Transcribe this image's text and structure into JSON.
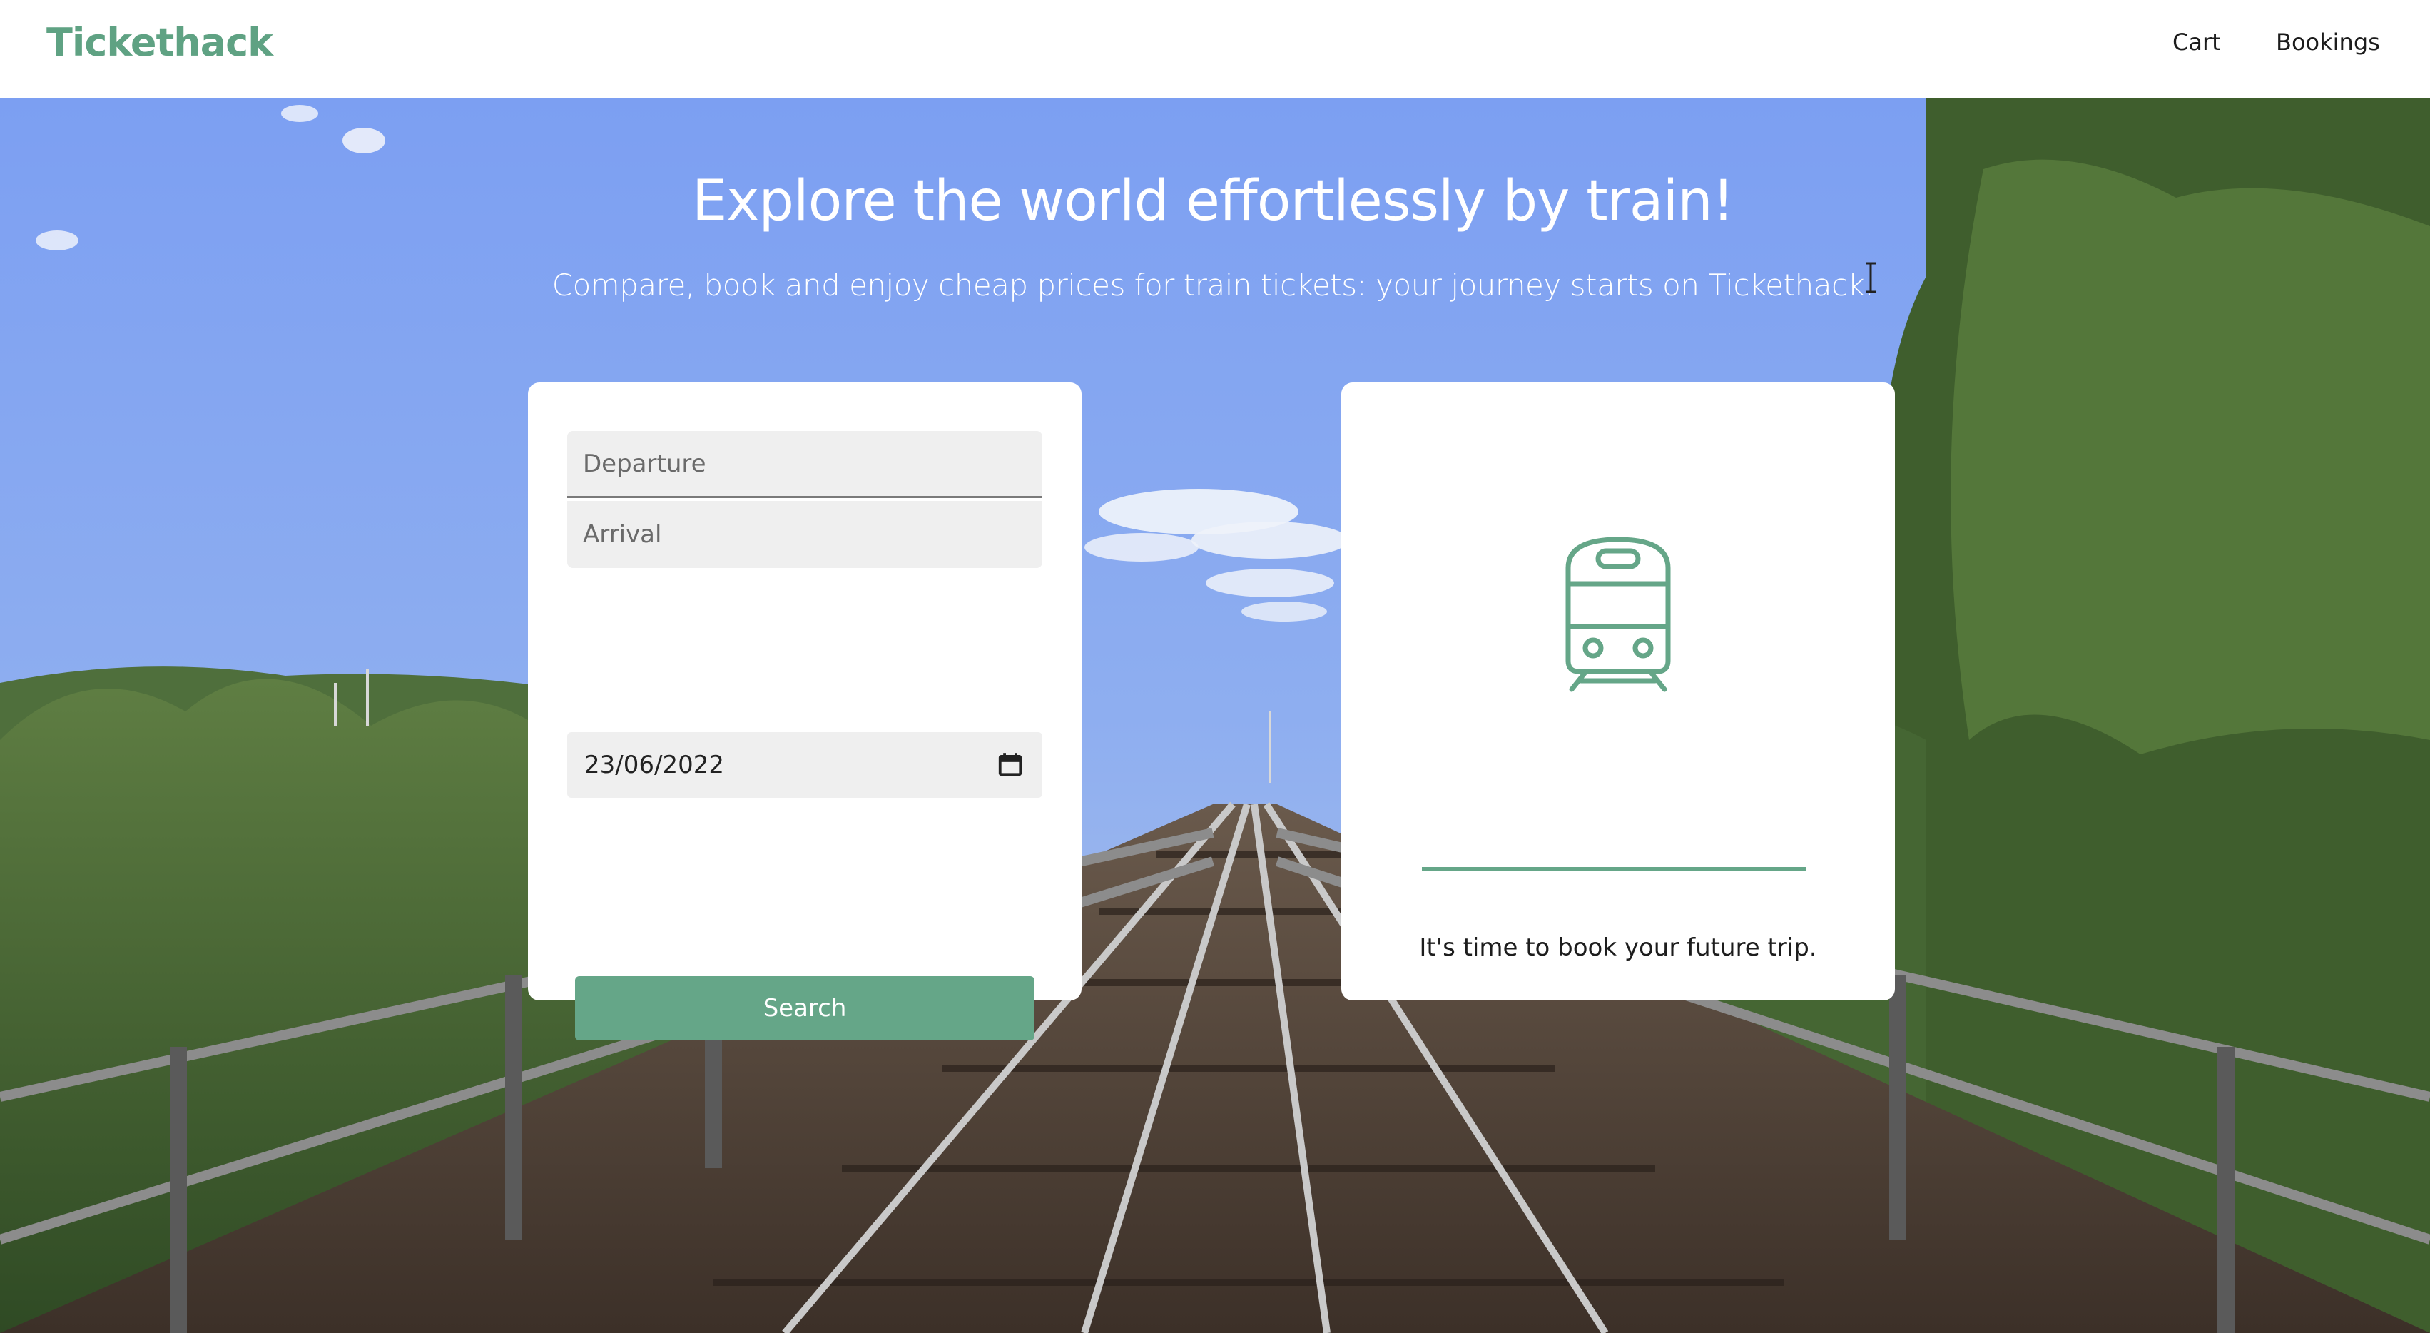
{
  "navbar": {
    "brand": "Tickethack",
    "links": [
      "Cart",
      "Bookings"
    ]
  },
  "hero": {
    "title": "Explore the world effortlessly by train!",
    "subtitle": "Compare, book and enjoy cheap prices for train tickets: your journey starts on Tickethack."
  },
  "search": {
    "departure_placeholder": "Departure",
    "arrival_placeholder": "Arrival",
    "date_value": "23/06/2022",
    "button_label": "Search"
  },
  "info": {
    "message": "It's time to book your future trip."
  },
  "icons": {
    "train": "train-icon",
    "calendar": "calendar-icon",
    "cursor": "text-cursor-icon"
  },
  "colors": {
    "brand": "#5fa283",
    "button": "#65a688",
    "card": "#ffffff",
    "field": "#efefef"
  }
}
